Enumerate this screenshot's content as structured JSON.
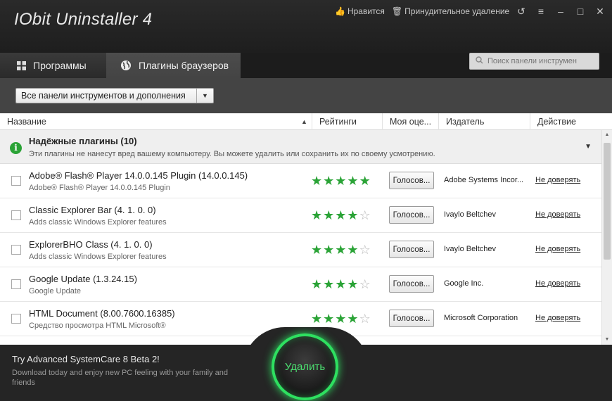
{
  "app": {
    "title": "IObit Uninstaller 4"
  },
  "header": {
    "like_label": "Нравится",
    "force_remove_label": "Принудительное удаление"
  },
  "tabs": [
    {
      "label": "Программы",
      "icon": "grid-icon"
    },
    {
      "label": "Плагины браузеров",
      "icon": "globe-icon",
      "active": true
    }
  ],
  "search": {
    "placeholder": "Поиск панели инструмен"
  },
  "filter": {
    "selected": "Все панели инструментов и дополнения"
  },
  "table": {
    "columns": [
      "Название",
      "Рейтинги",
      "Моя оце...",
      "Издатель",
      "Действие"
    ],
    "group": {
      "title": "Надёжные плагины (10)",
      "description": "Эти плагины не нанесут вред вашему компьютеру. Вы можете удалить или сохранить их по своему усмотрению."
    },
    "rows": [
      {
        "name": "Adobe® Flash® Player 14.0.0.145 Plugin (14.0.0.145)",
        "sub": "Adobe® Flash® Player 14.0.0.145 Plugin",
        "rating": 5,
        "vote": "Голосов...",
        "publisher": "Adobe Systems Incor...",
        "action": "Не доверять"
      },
      {
        "name": "Classic Explorer Bar (4. 1. 0. 0)",
        "sub": "Adds classic Windows Explorer features",
        "rating": 4,
        "vote": "Голосов...",
        "publisher": "Ivaylo Beltchev",
        "action": "Не доверять"
      },
      {
        "name": "ExplorerBHO Class (4. 1. 0. 0)",
        "sub": "Adds classic Windows Explorer features",
        "rating": 4,
        "vote": "Голосов...",
        "publisher": "Ivaylo Beltchev",
        "action": "Не доверять"
      },
      {
        "name": "Google Update (1.3.24.15)",
        "sub": "Google Update",
        "rating": 4,
        "vote": "Голосов...",
        "publisher": "Google Inc.",
        "action": "Не доверять"
      },
      {
        "name": "HTML Document (8.00.7600.16385)",
        "sub": "Средство просмотра HTML Microsoft®",
        "rating": 4,
        "vote": "Голосов...",
        "publisher": "Microsoft Corporation",
        "action": "Не доверять"
      }
    ]
  },
  "footer": {
    "promo_title": "Try Advanced SystemCare 8 Beta 2!",
    "promo_text": "Download today and enjoy new PC feeling with your family and friends",
    "uninstall_label": "Удалить"
  },
  "colors": {
    "accent": "#2aa336",
    "button_glow": "#2ee060"
  }
}
